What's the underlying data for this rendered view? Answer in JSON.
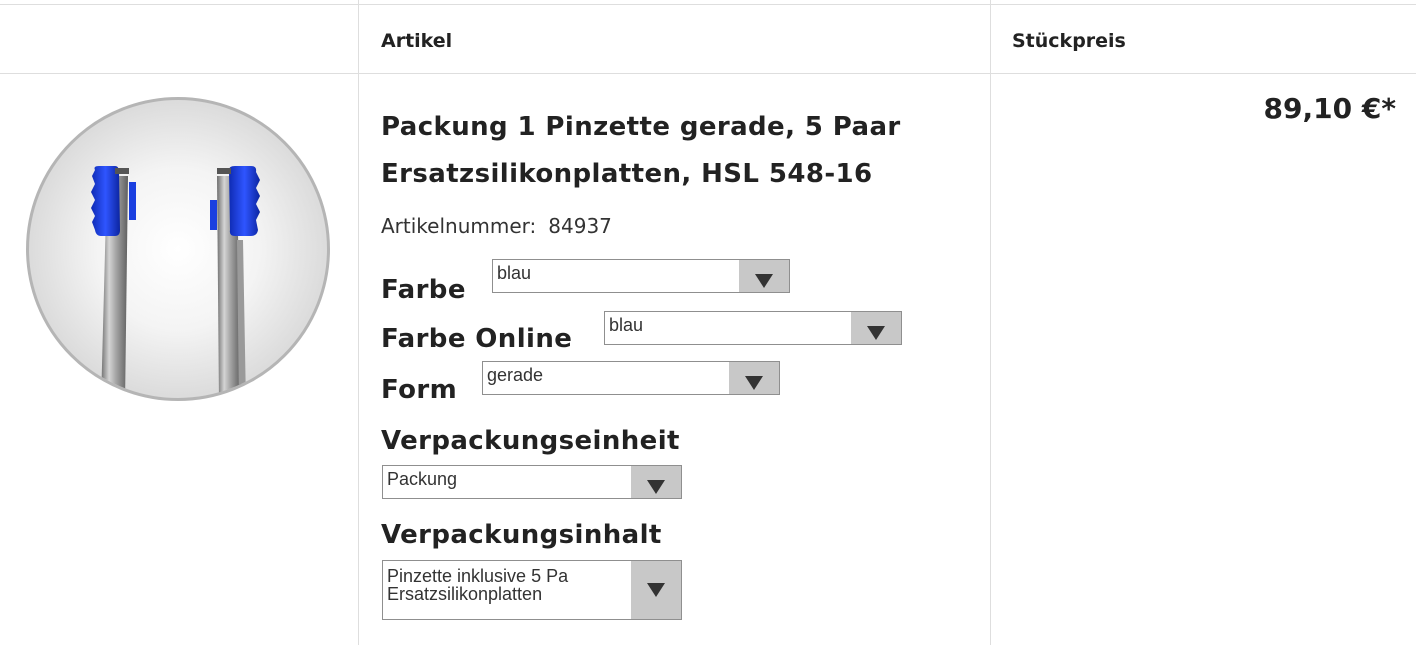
{
  "header": {
    "article_label": "Artikel",
    "unit_price_label": "Stückpreis"
  },
  "product": {
    "image_alt": "Pinzette mit blauen Silikonplatten",
    "title_line1": "Packung 1 Pinzette gerade, 5 Paar",
    "title_line2": "Ersatzsilikonplatten, HSL 548-16",
    "article_number_label": "Artikelnummer:",
    "article_number": "84937",
    "price": "89,10 €*"
  },
  "options": {
    "farbe": {
      "label": "Farbe",
      "value": "blau"
    },
    "farbe_online": {
      "label": "Farbe Online",
      "value": "blau"
    },
    "form": {
      "label": "Form",
      "value": "gerade"
    },
    "verpackungseinheit": {
      "label": "Verpackungseinheit",
      "value": "Packung"
    },
    "verpackungsinhalt": {
      "label": "Verpackungsinhalt",
      "value": "Pinzette inklusive 5 Pa\nErsatzsilikonplatten"
    }
  },
  "colors": {
    "border": "#dedede",
    "select_button": "#c8c8c8",
    "silicone_blue": "#1a3fe0",
    "text": "#222222"
  },
  "icons": {
    "dropdown": "triangle-down-icon"
  }
}
